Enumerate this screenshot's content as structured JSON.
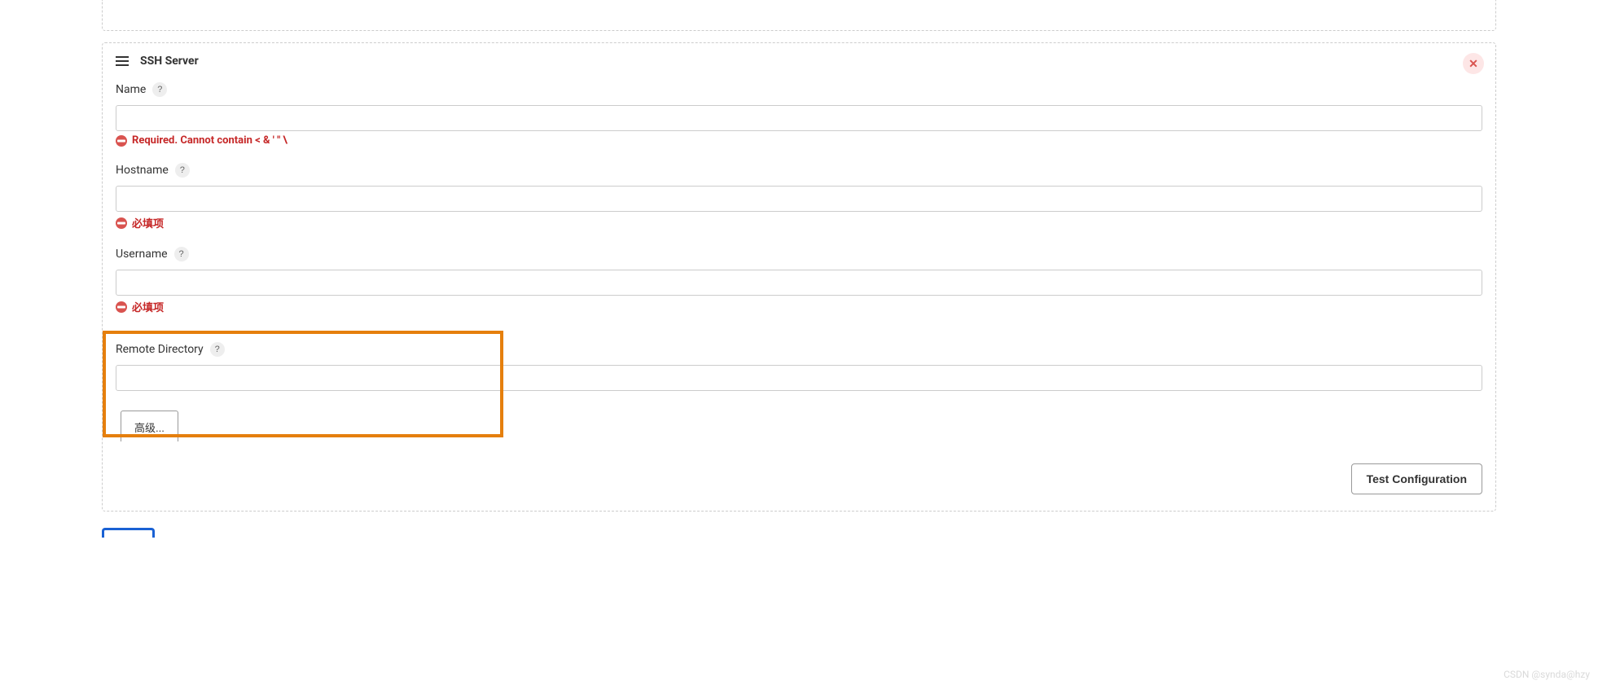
{
  "section": {
    "title": "SSH Server"
  },
  "fields": {
    "name": {
      "label": "Name",
      "value": "",
      "error": "Required. Cannot contain < & ' \" \\"
    },
    "hostname": {
      "label": "Hostname",
      "value": "",
      "error": "必填项"
    },
    "username": {
      "label": "Username",
      "value": "",
      "error": "必填项"
    },
    "remoteDirectory": {
      "label": "Remote Directory",
      "value": ""
    }
  },
  "buttons": {
    "help": "?",
    "close": "✕",
    "advanced": "高级...",
    "testConfiguration": "Test Configuration"
  },
  "watermark": "CSDN @synda@hzy"
}
